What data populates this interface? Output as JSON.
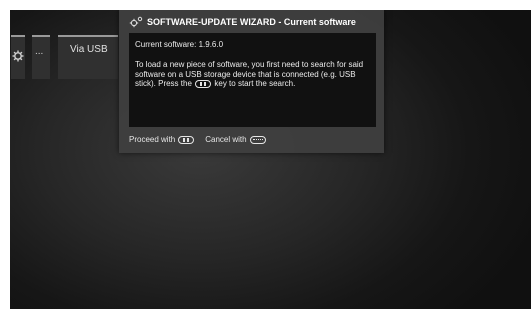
{
  "menu": {
    "settings_icon": "gear-icon",
    "more_label": "...",
    "source_label": "Via USB"
  },
  "dialog": {
    "title_icon": "gears-icon",
    "title": "SOFTWARE-UPDATE WIZARD - Current software",
    "current_software": "Current software: 1.9.6.0",
    "instructions_part1": "To load a new piece of software, you first need to search for said software on a USB storage device that is connected (e.g. USB stick). Press the",
    "instructions_key_icon": "ok-key-icon",
    "instructions_part2": "key to start the search.",
    "proceed_label": "Proceed with",
    "proceed_key_icon": "ok-key-icon",
    "cancel_label": "Cancel with",
    "cancel_key_icon": "esc-key-icon"
  },
  "colors": {
    "background": "#1a1a1a",
    "dialog": "#3e3e3e",
    "dialog_body": "#111111",
    "text": "#ececec"
  }
}
